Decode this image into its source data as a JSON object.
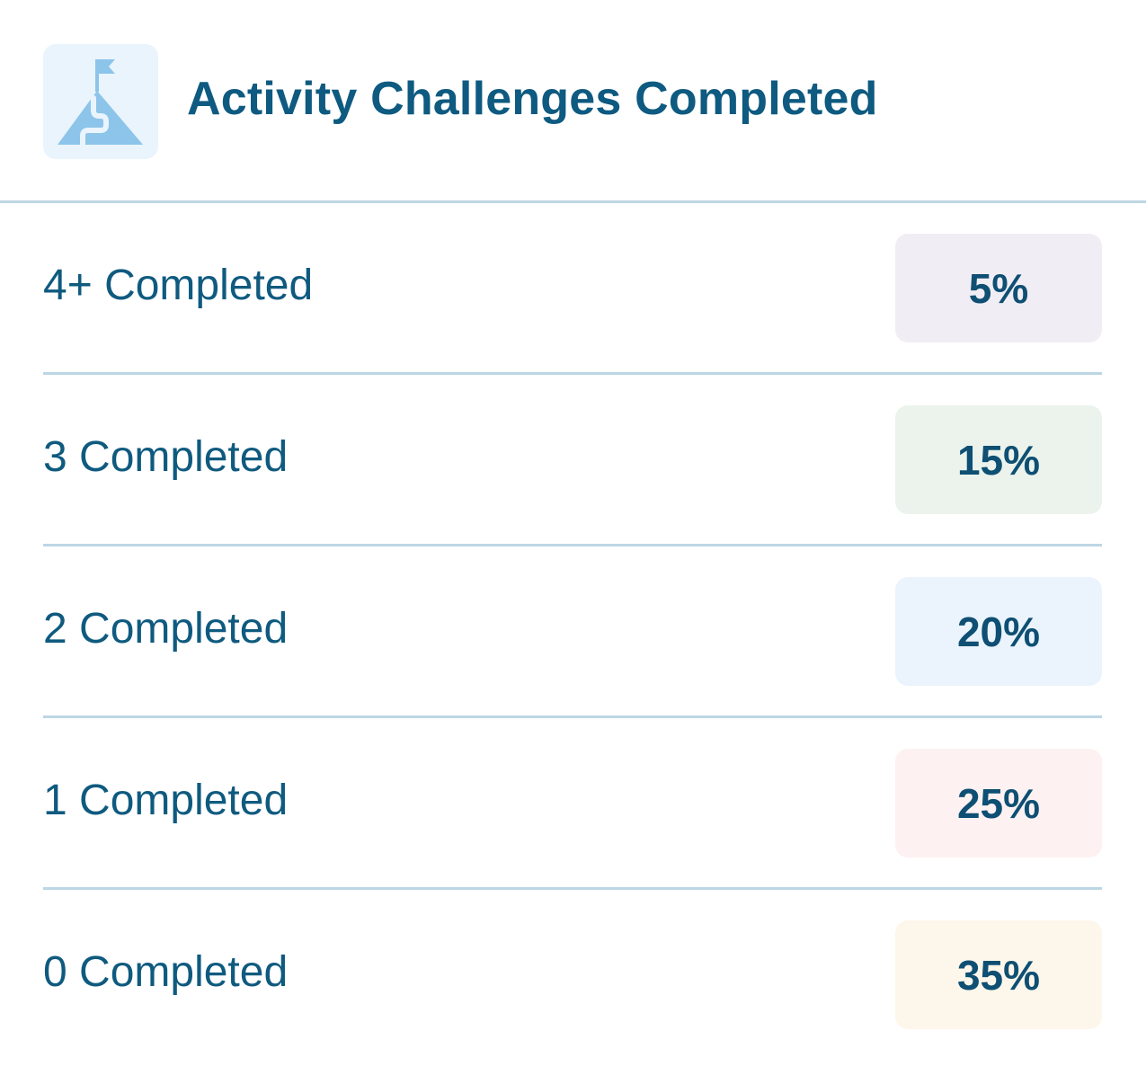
{
  "header": {
    "title": "Activity Challenges Completed",
    "icon": "mountain-flag-icon",
    "icon_color": "#8cc4ea",
    "icon_bg": "#eaf4fc"
  },
  "rows": [
    {
      "label": "4+ Completed",
      "value": "5%",
      "badge_color": "#f1edf5"
    },
    {
      "label": "3 Completed",
      "value": "15%",
      "badge_color": "#ebf3ec"
    },
    {
      "label": "2 Completed",
      "value": "20%",
      "badge_color": "#ebf4fc"
    },
    {
      "label": "1 Completed",
      "value": "25%",
      "badge_color": "#fdf1f1"
    },
    {
      "label": "0 Completed",
      "value": "35%",
      "badge_color": "#fdf6ea"
    }
  ]
}
